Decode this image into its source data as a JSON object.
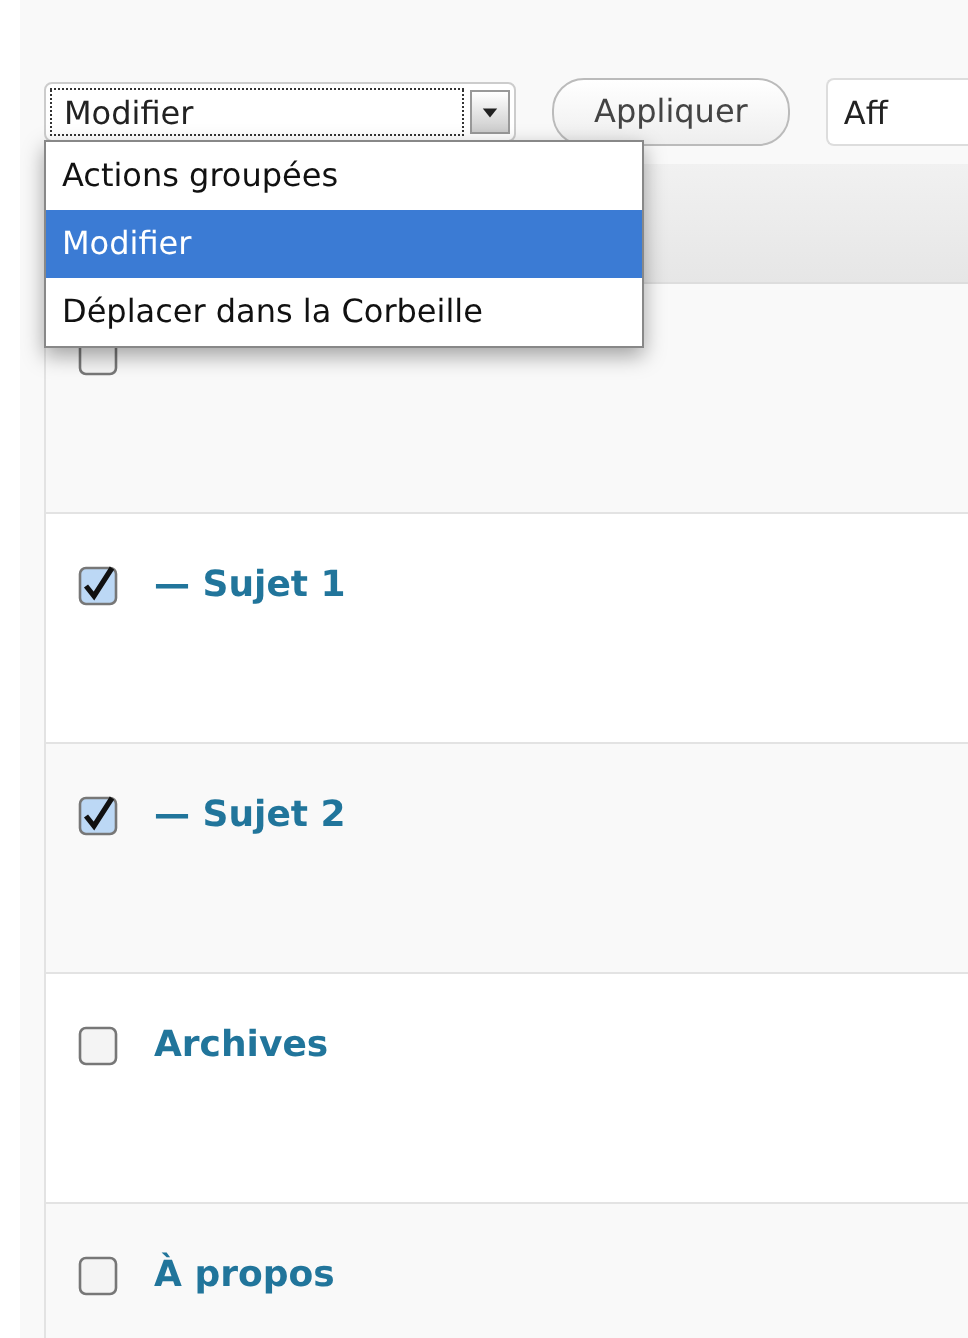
{
  "bulk_actions": {
    "value": "Modifier",
    "options": [
      {
        "label": "Actions groupées",
        "selected": false
      },
      {
        "label": "Modifier",
        "selected": true
      },
      {
        "label": "Déplacer dans la Corbeille",
        "selected": false
      }
    ]
  },
  "apply_button": "Appliquer",
  "cut_button": "Aff",
  "rows": [
    {
      "title": null,
      "checked": false
    },
    {
      "title": "— Sujet 1",
      "checked": true
    },
    {
      "title": "— Sujet 2",
      "checked": true
    },
    {
      "title": "Archives",
      "checked": false
    },
    {
      "title": "À propos",
      "checked": false
    }
  ]
}
